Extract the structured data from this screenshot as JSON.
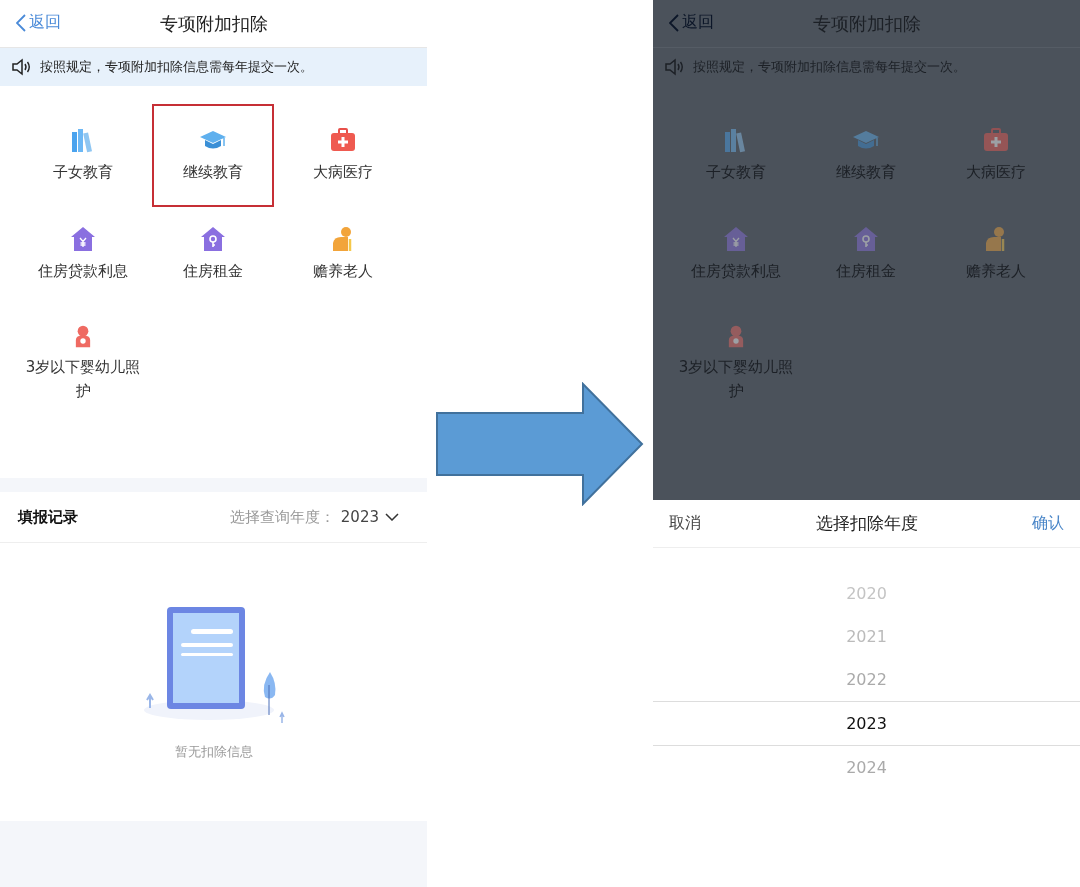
{
  "screens": [
    {
      "dimmed": false,
      "back": "返回",
      "title": "专项附加扣除",
      "notice": "按照规定，专项附加扣除信息需每年提交一次。",
      "items": [
        {
          "label": "子女教育",
          "highlighted": false
        },
        {
          "label": "继续教育",
          "highlighted": true
        },
        {
          "label": "大病医疗",
          "highlighted": false
        },
        {
          "label": "住房贷款利息",
          "highlighted": false
        },
        {
          "label": "住房租金",
          "highlighted": false
        },
        {
          "label": "赡养老人",
          "highlighted": false
        },
        {
          "label": "3岁以下婴幼儿照护",
          "highlighted": false
        }
      ],
      "records": {
        "title": "填报记录",
        "year_label": "选择查询年度：",
        "year": "2023",
        "empty": "暂无扣除信息"
      }
    },
    {
      "dimmed": true,
      "back": "返回",
      "title": "专项附加扣除",
      "notice": "按照规定，专项附加扣除信息需每年提交一次。",
      "items": [
        {
          "label": "子女教育",
          "highlighted": false
        },
        {
          "label": "继续教育",
          "highlighted": false
        },
        {
          "label": "大病医疗",
          "highlighted": false
        },
        {
          "label": "住房贷款利息",
          "highlighted": false
        },
        {
          "label": "住房租金",
          "highlighted": false
        },
        {
          "label": "赡养老人",
          "highlighted": false
        },
        {
          "label": "3岁以下婴幼儿照护",
          "highlighted": false
        }
      ],
      "picker": {
        "cancel": "取消",
        "title": "选择扣除年度",
        "confirm": "确认",
        "years": [
          {
            "label": "2020",
            "selected": false
          },
          {
            "label": "2021",
            "selected": false
          },
          {
            "label": "2022",
            "selected": false
          },
          {
            "label": "2023",
            "selected": true
          },
          {
            "label": "2024",
            "selected": false
          }
        ]
      }
    }
  ]
}
